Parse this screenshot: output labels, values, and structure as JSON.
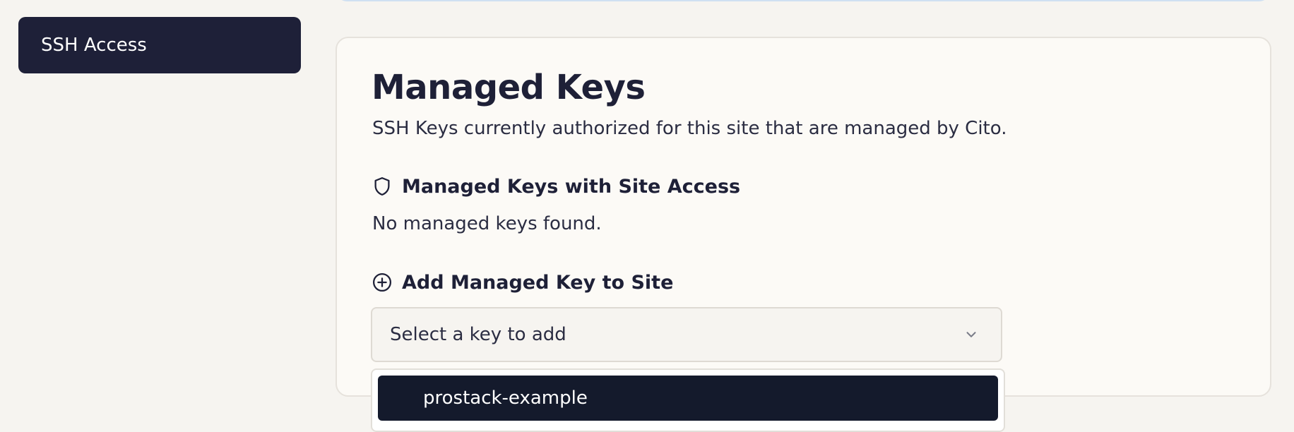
{
  "sidebar": {
    "items": [
      {
        "label": "SSH Access",
        "active": true
      }
    ]
  },
  "card": {
    "title": "Managed Keys",
    "subtitle": "SSH Keys currently authorized for this site that are managed by Cito.",
    "existing_section": {
      "icon": "shield-icon",
      "heading": "Managed Keys with Site Access",
      "empty_text": "No managed keys found."
    },
    "add_section": {
      "icon": "plus-circle-icon",
      "heading": "Add Managed Key to Site",
      "select": {
        "placeholder": "Select a key to add",
        "icon": "chevron-down-icon",
        "options": [
          "prostack-example"
        ],
        "highlighted_option": "prostack-example"
      }
    }
  },
  "colors": {
    "sidebar_active_bg": "#1e2038",
    "page_bg": "#f6f4f0",
    "card_bg": "#fcfaf6",
    "text_primary": "#1e2037",
    "option_highlight_bg": "#141a2c"
  }
}
